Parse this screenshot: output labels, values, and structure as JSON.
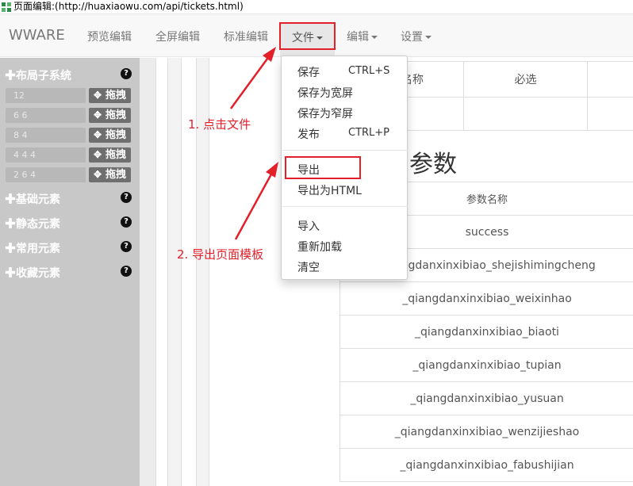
{
  "window": {
    "title": "页面编辑:(http://huaxiaowu.com/api/tickets.html)"
  },
  "navbar": {
    "brand": "WWARE",
    "items": [
      "预览编辑",
      "全屏编辑",
      "标准编辑"
    ],
    "file_menu": "文件",
    "edit_menu": "编辑",
    "settings_menu": "设置"
  },
  "sidebar": {
    "layout_title": "布局子系统",
    "layouts": [
      "12",
      "6 6",
      "8 4",
      "4 4 4",
      "2 6 4"
    ],
    "drag_label": "拖拽",
    "sections": [
      "基础元素",
      "静态元素",
      "常用元素",
      "收藏元素"
    ],
    "help_icon": "?"
  },
  "file_dropdown": {
    "group1": [
      {
        "label": "保存",
        "shortcut": "CTRL+S"
      },
      {
        "label": "保存为宽屏",
        "shortcut": ""
      },
      {
        "label": "保存为窄屏",
        "shortcut": ""
      },
      {
        "label": "发布",
        "shortcut": "CTRL+P"
      }
    ],
    "group2": [
      "导出",
      "导出为HTML"
    ],
    "group3": [
      "导入",
      "重新加载",
      "清空"
    ]
  },
  "content": {
    "table1_headers": [
      "名称",
      "必选"
    ],
    "heading": "回参数",
    "table2_header": "参数名称",
    "table2_rows": [
      "success",
      "_qiangdanxinxibiao_shejishimingcheng",
      "_qiangdanxinxibiao_weixinhao",
      "_qiangdanxinxibiao_biaoti",
      "_qiangdanxinxibiao_tupian",
      "_qiangdanxinxibiao_yusuan",
      "_qiangdanxinxibiao_wenzijieshao",
      "_qiangdanxinxibiao_fabushijian"
    ]
  },
  "annotations": {
    "step1": "1. 点击文件",
    "step2": "2. 导出页面模板"
  },
  "colors": {
    "annotation": "#e3202a",
    "sidebar": "#c8c8c8",
    "navbar": "#f8f8f8"
  }
}
